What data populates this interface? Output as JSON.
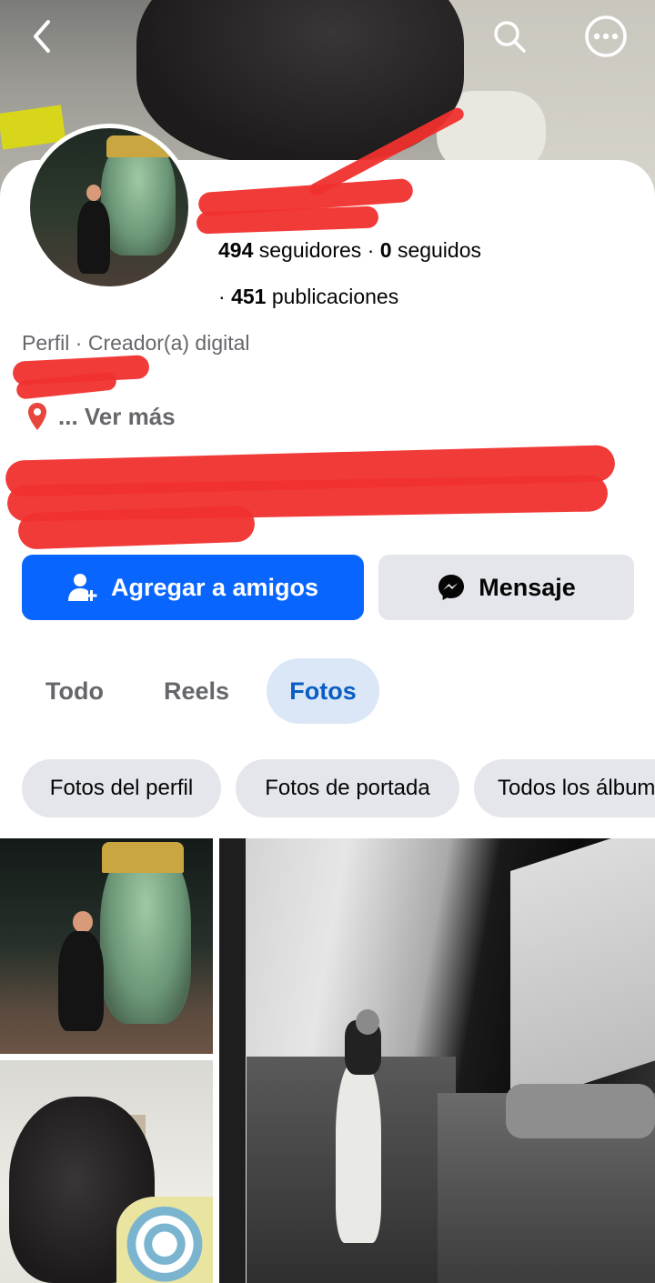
{
  "header": {
    "back_icon": "back-arrow-icon",
    "search_icon": "search-icon",
    "more_icon": "more-options-icon"
  },
  "profile": {
    "followers_count": "494",
    "followers_label": "seguidores",
    "separator": "·",
    "following_count": "0",
    "following_label": "seguidos",
    "posts_prefix": "·",
    "posts_count": "451",
    "posts_label": "publicaciones",
    "category": "Perfil · Creador(a) digital",
    "location_icon": "location-pin-icon",
    "see_more": "... Ver más"
  },
  "actions": {
    "add_friend_label": "Agregar a amigos",
    "add_friend_icon": "add-friend-icon",
    "message_label": "Mensaje",
    "message_icon": "messenger-icon"
  },
  "tabs": [
    {
      "label": "Todo",
      "active": false
    },
    {
      "label": "Reels",
      "active": false
    },
    {
      "label": "Fotos",
      "active": true
    }
  ],
  "photo_filters": [
    {
      "label": "Fotos del perfil"
    },
    {
      "label": "Fotos de portada"
    },
    {
      "label": "Todos los álbum"
    }
  ],
  "colors": {
    "primary_button": "#0866ff",
    "secondary_button": "#e4e6eb",
    "active_tab_bg": "#dbe7f6",
    "active_tab_text": "#0a5dc2",
    "muted_text": "#65676b",
    "redaction": "#f0302e"
  }
}
